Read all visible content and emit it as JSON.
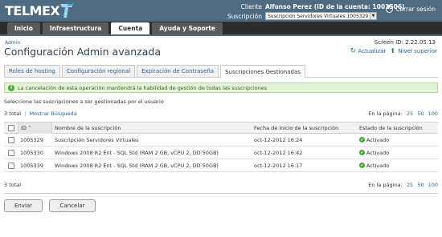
{
  "header": {
    "logo_text": "TELMEX",
    "client_label": "Cliente",
    "client_value": "Alfonso Perez (ID de la cuenta: 1001506)",
    "subscription_label": "Suscripción",
    "subscription_selected": "Suscripción Servidores Virtuales:1005329",
    "logout_label": "Cerrar sesión"
  },
  "nav": {
    "tabs": [
      {
        "label": "Inicio",
        "active": false
      },
      {
        "label": "Infraestructura",
        "active": false
      },
      {
        "label": "Cuenta",
        "active": true
      },
      {
        "label": "Ayuda y Soporte",
        "active": false
      }
    ]
  },
  "page": {
    "breadcrumb": "Admin",
    "title": "Configuración Admin avanzada",
    "screen_id": "Screen ID:  2.22.05.13",
    "refresh_label": "Actualizar",
    "up_label": "Nivel superior"
  },
  "sub_tabs": [
    {
      "label": "Roles de hosting",
      "active": false
    },
    {
      "label": "Configuración regional",
      "active": false
    },
    {
      "label": "Expiración de Contraseña",
      "active": false
    },
    {
      "label": "Suscripciones Gestionadas",
      "active": true
    }
  ],
  "banner": {
    "text": "La cancelación de esta operación mantendrá la habilidad de gestión de todas las suscripciones"
  },
  "instruction": "Seleccione las suscripciones a ser gestionadas por el usuario",
  "list": {
    "total_top": "3 total",
    "separator": "|",
    "show_search": "Mostrar Búsqueda",
    "per_page_label": "En la página:",
    "per_page_options": [
      "25",
      "50",
      "100"
    ],
    "total_bottom": "3 total"
  },
  "table": {
    "headers": {
      "id": "ID",
      "sort_indicator": "^",
      "name": "Nombre de la suscripción",
      "date": "Fecha de inicio de la suscripción",
      "state": "Estado de la suscripción"
    },
    "rows": [
      {
        "id": "1005329",
        "name": "Suscripción Servidores Virtuales",
        "date": "oct-12-2012 16:24",
        "state": "Activado"
      },
      {
        "id": "1005330",
        "name": "Windows 2008 R2 Ent - SQL Std (RAM 2 GB, vCPU 2, DD 50GB)",
        "date": "oct-12-2012 16:42",
        "state": "Activado"
      },
      {
        "id": "1005339",
        "name": "Windows 2008 R2 Ent - SQL Std (RAM 2 GB, vCPU 2, DD 50GB)",
        "date": "oct-12-2012 16:17",
        "state": "Activado"
      }
    ]
  },
  "buttons": {
    "send": "Enviar",
    "cancel": "Cancelar"
  },
  "colors": {
    "header_bg": "#4e6b82",
    "nav_bg": "#2c2c2c",
    "link": "#2a6496",
    "success": "#4aa63c",
    "banner_bg": "#e4f2d6"
  }
}
